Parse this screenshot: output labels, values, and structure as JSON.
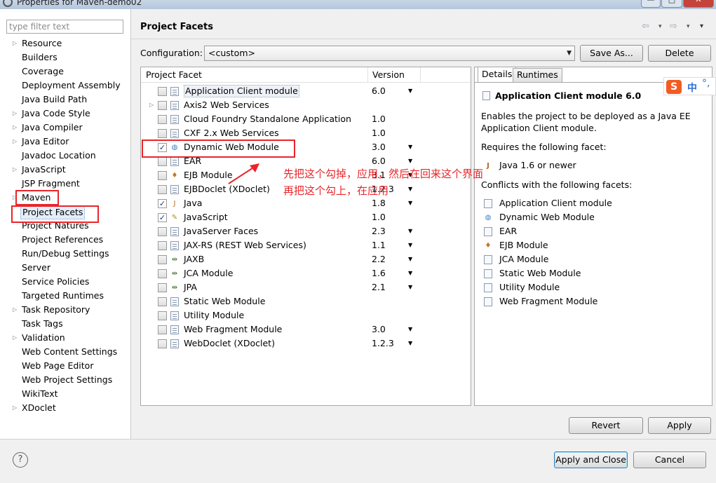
{
  "window": {
    "title": "Properties for Maven-demo02",
    "minimize_glyph": "—",
    "maximize_glyph": "□",
    "close_glyph": "✕"
  },
  "filter": {
    "placeholder": "type filter text"
  },
  "nav_items": [
    {
      "label": "Resource",
      "twisty": true
    },
    {
      "label": "Builders",
      "twisty": false
    },
    {
      "label": "Coverage",
      "twisty": false
    },
    {
      "label": "Deployment Assembly",
      "twisty": false
    },
    {
      "label": "Java Build Path",
      "twisty": false
    },
    {
      "label": "Java Code Style",
      "twisty": true
    },
    {
      "label": "Java Compiler",
      "twisty": true
    },
    {
      "label": "Java Editor",
      "twisty": true
    },
    {
      "label": "Javadoc Location",
      "twisty": false
    },
    {
      "label": "JavaScript",
      "twisty": true
    },
    {
      "label": "JSP Fragment",
      "twisty": false
    },
    {
      "label": "Maven",
      "twisty": true
    },
    {
      "label": "Project Facets",
      "twisty": false,
      "selected": true
    },
    {
      "label": "Project Natures",
      "twisty": false
    },
    {
      "label": "Project References",
      "twisty": false
    },
    {
      "label": "Run/Debug Settings",
      "twisty": false
    },
    {
      "label": "Server",
      "twisty": false
    },
    {
      "label": "Service Policies",
      "twisty": false
    },
    {
      "label": "Targeted Runtimes",
      "twisty": false
    },
    {
      "label": "Task Repository",
      "twisty": true
    },
    {
      "label": "Task Tags",
      "twisty": false
    },
    {
      "label": "Validation",
      "twisty": true
    },
    {
      "label": "Web Content Settings",
      "twisty": false
    },
    {
      "label": "Web Page Editor",
      "twisty": false
    },
    {
      "label": "Web Project Settings",
      "twisty": false
    },
    {
      "label": "WikiText",
      "twisty": false
    },
    {
      "label": "XDoclet",
      "twisty": true
    }
  ],
  "header": {
    "title": "Project Facets",
    "back_icon": "⇦",
    "forward_icon": "⇨",
    "menu_arrow": "▾"
  },
  "configuration": {
    "label": "Configuration:",
    "value": "<custom>",
    "save_as": "Save As...",
    "delete": "Delete"
  },
  "facets": {
    "col_facet": "Project Facet",
    "col_version": "Version",
    "rows": [
      {
        "name": "Application Client module",
        "version": "6.0",
        "checked": false,
        "dropdown": true,
        "icon": "page",
        "highlighted": true
      },
      {
        "name": "Axis2 Web Services",
        "version": "",
        "checked": false,
        "dropdown": false,
        "icon": "page",
        "twisty": true
      },
      {
        "name": "Cloud Foundry Standalone Application",
        "version": "1.0",
        "checked": false,
        "dropdown": false,
        "icon": "page"
      },
      {
        "name": "CXF 2.x Web Services",
        "version": "1.0",
        "checked": false,
        "dropdown": false,
        "icon": "page"
      },
      {
        "name": "Dynamic Web Module",
        "version": "3.0",
        "checked": true,
        "dropdown": true,
        "icon": "globe"
      },
      {
        "name": "EAR",
        "version": "6.0",
        "checked": false,
        "dropdown": true,
        "icon": "page"
      },
      {
        "name": "EJB Module",
        "version": "3.1",
        "checked": false,
        "dropdown": true,
        "icon": "bean"
      },
      {
        "name": "EJBDoclet (XDoclet)",
        "version": "1.2.3",
        "checked": false,
        "dropdown": true,
        "icon": "page"
      },
      {
        "name": "Java",
        "version": "1.8",
        "checked": true,
        "dropdown": true,
        "icon": "java"
      },
      {
        "name": "JavaScript",
        "version": "1.0",
        "checked": true,
        "dropdown": false,
        "icon": "js"
      },
      {
        "name": "JavaServer Faces",
        "version": "2.3",
        "checked": false,
        "dropdown": true,
        "icon": "page"
      },
      {
        "name": "JAX-RS (REST Web Services)",
        "version": "1.1",
        "checked": false,
        "dropdown": true,
        "icon": "page"
      },
      {
        "name": "JAXB",
        "version": "2.2",
        "checked": false,
        "dropdown": true,
        "icon": "arrows"
      },
      {
        "name": "JCA Module",
        "version": "1.6",
        "checked": false,
        "dropdown": true,
        "icon": "arrows"
      },
      {
        "name": "JPA",
        "version": "2.1",
        "checked": false,
        "dropdown": true,
        "icon": "arrows"
      },
      {
        "name": "Static Web Module",
        "version": "",
        "checked": false,
        "dropdown": false,
        "icon": "page"
      },
      {
        "name": "Utility Module",
        "version": "",
        "checked": false,
        "dropdown": false,
        "icon": "page"
      },
      {
        "name": "Web Fragment Module",
        "version": "3.0",
        "checked": false,
        "dropdown": true,
        "icon": "page"
      },
      {
        "name": "WebDoclet (XDoclet)",
        "version": "1.2.3",
        "checked": false,
        "dropdown": true,
        "icon": "page"
      }
    ]
  },
  "details": {
    "tab_details": "Details",
    "tab_runtimes": "Runtimes",
    "title": "Application Client module 6.0",
    "description_line1": "Enables the project to be deployed as a Java EE",
    "description_line2": "Application Client module.",
    "requires_label": "Requires the following facet:",
    "requires_item": "Java 1.6 or newer",
    "conflicts_label": "Conflicts with the following facets:",
    "conflicts": [
      {
        "name": "Application Client module",
        "icon": "page"
      },
      {
        "name": "Dynamic Web Module",
        "icon": "globe"
      },
      {
        "name": "EAR",
        "icon": "page"
      },
      {
        "name": "EJB Module",
        "icon": "bean"
      },
      {
        "name": "JCA Module",
        "icon": "page"
      },
      {
        "name": "Static Web Module",
        "icon": "page"
      },
      {
        "name": "Utility Module",
        "icon": "page"
      },
      {
        "name": "Web Fragment Module",
        "icon": "page"
      }
    ]
  },
  "ime": {
    "logo": "S",
    "mode": "中",
    "punct": "°,"
  },
  "annotation": {
    "line1": "先把这个勾掉，应用，然后在回来这个界面",
    "line2": "再把这个勾上，在应用"
  },
  "buttons": {
    "revert": "Revert",
    "apply": "Apply",
    "apply_close": "Apply and Close",
    "cancel": "Cancel",
    "help": "?"
  },
  "colors": {
    "annotation_red": "#e8252a",
    "selection_bg": "#e4eefa"
  }
}
